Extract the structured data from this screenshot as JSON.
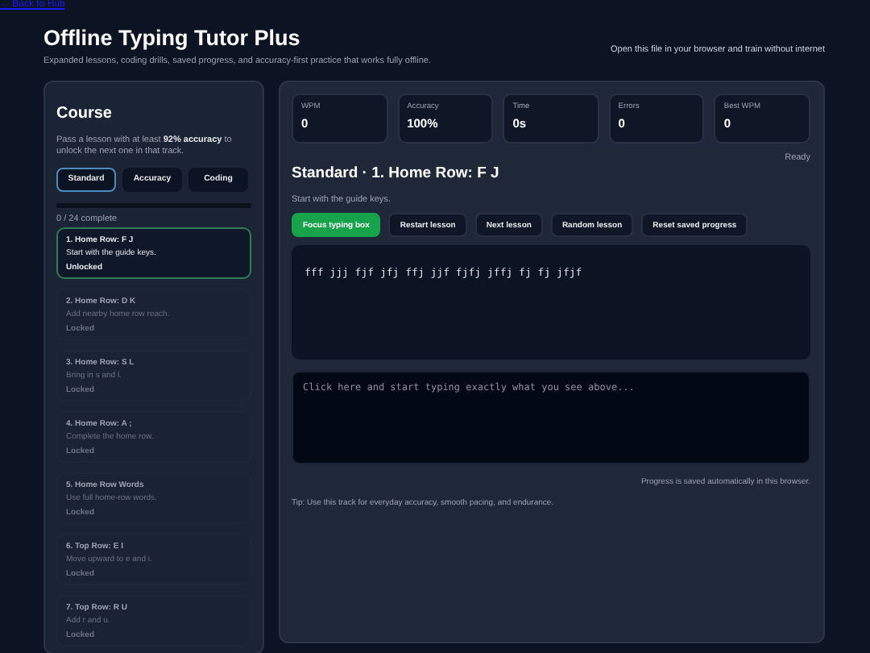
{
  "back_link": "← Back to Hub",
  "header": {
    "title": "Offline Typing Tutor Plus",
    "subtitle": "Expanded lessons, coding drills, saved progress, and accuracy-first practice that works fully offline.",
    "note": "Open this file in your browser and train without internet"
  },
  "sidebar": {
    "title": "Course",
    "hint": "Pass a lesson with at least **92% accuracy** to unlock the next one in that track.",
    "tracks": [
      {
        "label": "Standard",
        "selected": true
      },
      {
        "label": "Accuracy",
        "selected": false
      },
      {
        "label": "Coding",
        "selected": false
      }
    ],
    "progress": {
      "level": 0,
      "label": "0 / 24 complete"
    },
    "lessons": [
      {
        "title": "1. Home Row: F J",
        "description": "Start with the guide keys.",
        "status": "Unlocked",
        "locked": false,
        "selected": true
      },
      {
        "title": "2. Home Row: D K",
        "description": "Add nearby home row reach.",
        "status": "Locked",
        "locked": true,
        "selected": false
      },
      {
        "title": "3. Home Row: S L",
        "description": "Bring in s and l.",
        "status": "Locked",
        "locked": true,
        "selected": false
      },
      {
        "title": "4. Home Row: A ;",
        "description": "Complete the home row.",
        "status": "Locked",
        "locked": true,
        "selected": false
      },
      {
        "title": "5. Home Row Words",
        "description": "Use full home-row words.",
        "status": "Locked",
        "locked": true,
        "selected": false
      },
      {
        "title": "6. Top Row: E I",
        "description": "Move upward to e and i.",
        "status": "Locked",
        "locked": true,
        "selected": false
      },
      {
        "title": "7. Top Row: R U",
        "description": "Add r and u.",
        "status": "Locked",
        "locked": true,
        "selected": false
      }
    ]
  },
  "main": {
    "stats": [
      {
        "label": "WPM",
        "value": "0"
      },
      {
        "label": "Accuracy",
        "value": "100%"
      },
      {
        "label": "Time",
        "value": "0s"
      },
      {
        "label": "Errors",
        "value": "0"
      },
      {
        "label": "Best WPM",
        "value": "0"
      }
    ],
    "status": "Ready",
    "lesson_title": "Standard · 1. Home Row: F J",
    "lesson_description": "Start with the guide keys.",
    "buttons": [
      {
        "label": "Focus typing box",
        "kind": "primary"
      },
      {
        "label": "Restart lesson",
        "kind": "secondary"
      },
      {
        "label": "Next lesson",
        "kind": "secondary"
      },
      {
        "label": "Random lesson",
        "kind": "secondary"
      },
      {
        "label": "Reset saved progress",
        "kind": "secondary"
      }
    ],
    "target_text": "fff jjj fjf jfj ffj jjf fjfj jffj fj fj jfjf",
    "typing_box": {
      "placeholder": "Click here and start typing exactly what you see above..."
    },
    "save_note": "Progress is saved automatically in this browser.",
    "tip": "Tip: Use this track for everyday accuracy, smooth pacing, and endurance."
  }
}
